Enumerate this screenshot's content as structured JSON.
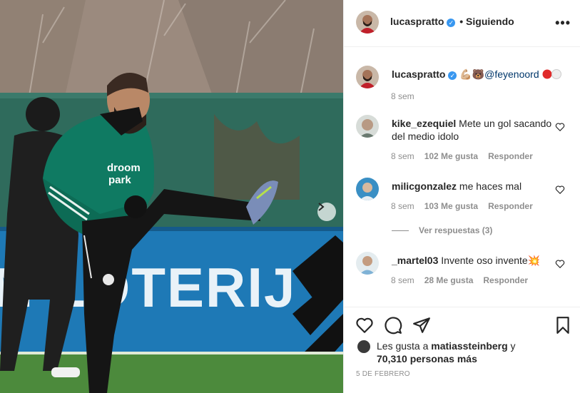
{
  "post": {
    "author": "lucaspratto",
    "follow_status": "• Siguiendo",
    "caption_emojis": "💪🏼🐻",
    "caption_mention": "@feyenoord",
    "caption_time": "8 sem",
    "colors": {
      "link": "#00376b",
      "verified": "#3897f0",
      "muted": "#8e8e8e"
    }
  },
  "comments": [
    {
      "user": "kike_ezequiel",
      "text": "Mete un gol sacando del medio idolo",
      "time": "8 sem",
      "likes": "102 Me gusta",
      "reply": "Responder"
    },
    {
      "user": "milicgonzalez",
      "text": "me haces mal",
      "time": "8 sem",
      "likes": "103 Me gusta",
      "reply": "Responder"
    },
    {
      "user": "_martel03",
      "text": "Invente oso invente💥",
      "time": "8 sem",
      "likes": "28 Me gusta",
      "reply": "Responder"
    }
  ],
  "view_replies": "Ver respuestas (3)",
  "likes_summary": {
    "prefix": "Les gusta a",
    "user": "matiassteinberg",
    "conj": "y",
    "others": "70,310 personas más"
  },
  "post_date": "5 DE FEBRERO",
  "photo_text": {
    "sponsor": "droom\npark",
    "banner": "N LOTERIJ"
  }
}
